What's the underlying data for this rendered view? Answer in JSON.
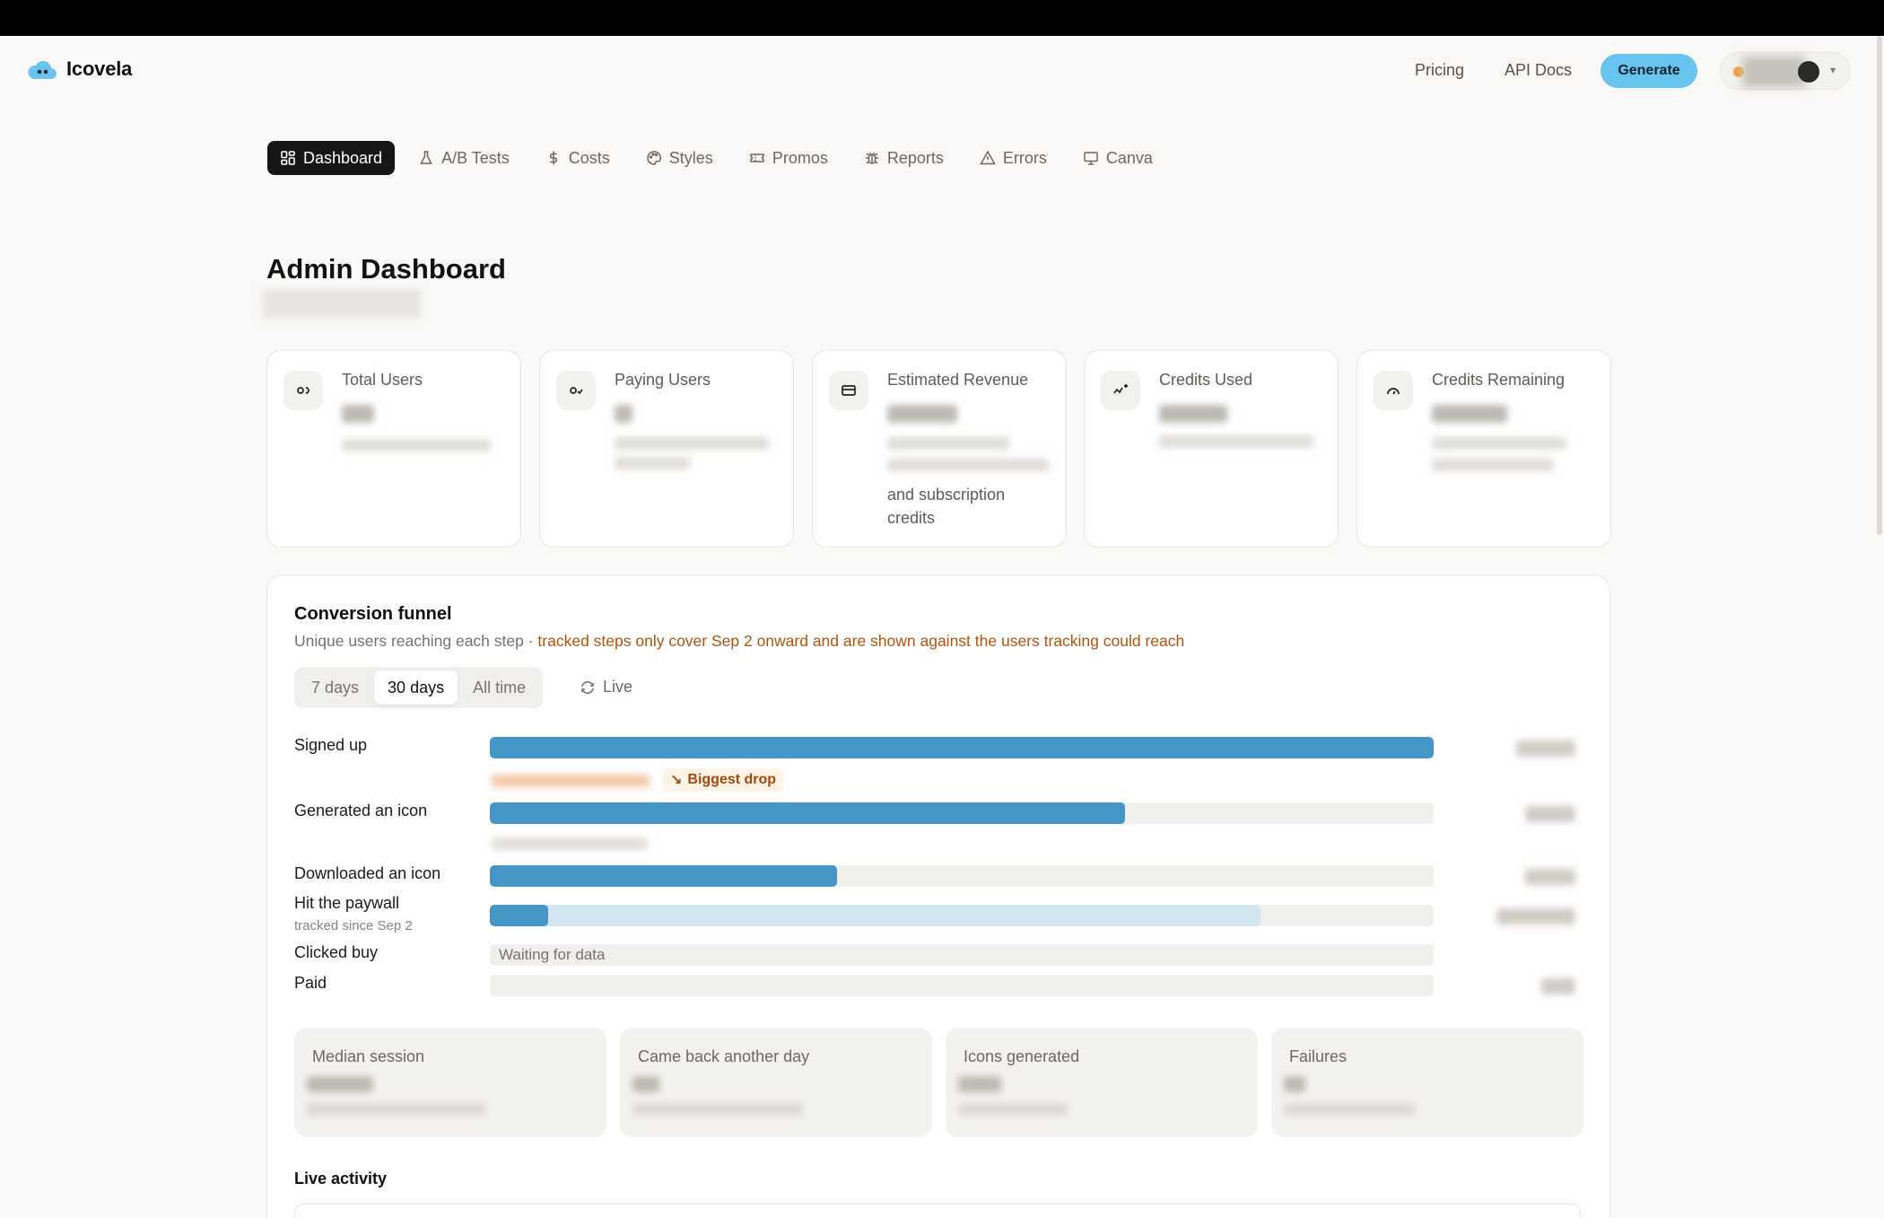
{
  "app": {
    "name": "Icovela"
  },
  "header": {
    "nav": [
      {
        "label": "Pricing"
      },
      {
        "label": "API Docs"
      }
    ],
    "generate_label": "Generate"
  },
  "tabs": [
    {
      "label": "Dashboard",
      "icon": "dashboard-icon",
      "active": true
    },
    {
      "label": "A/B Tests",
      "icon": "flask-icon"
    },
    {
      "label": "Costs",
      "icon": "dollar-icon"
    },
    {
      "label": "Styles",
      "icon": "palette-icon"
    },
    {
      "label": "Promos",
      "icon": "ticket-icon"
    },
    {
      "label": "Reports",
      "icon": "bug-icon"
    },
    {
      "label": "Errors",
      "icon": "warning-icon"
    },
    {
      "label": "Canva",
      "icon": "monitor-icon"
    }
  ],
  "page": {
    "title": "Admin Dashboard"
  },
  "stats": [
    {
      "label": "Total Users",
      "icon": "users-icon"
    },
    {
      "label": "Paying Users",
      "icon": "user-check-icon"
    },
    {
      "label": "Estimated Revenue",
      "icon": "card-icon",
      "note": "and subscription credits"
    },
    {
      "label": "Credits Used",
      "icon": "activity-icon"
    },
    {
      "label": "Credits Remaining",
      "icon": "gauge-icon"
    }
  ],
  "funnel": {
    "title": "Conversion funnel",
    "description": "Unique users reaching each step",
    "warning": " · tracked steps only cover Sep 2 onward and are shown against the users tracking could reach",
    "ranges": [
      {
        "label": "7 days"
      },
      {
        "label": "30 days",
        "active": true
      },
      {
        "label": "All time"
      }
    ],
    "live_label": "Live",
    "biggest_drop_label": "Biggest drop",
    "steps": [
      {
        "label": "Signed up",
        "fill": 1.0
      },
      {
        "label": "Generated an icon",
        "fill": 0.673
      },
      {
        "label": "Downloaded an icon",
        "fill": 0.368
      },
      {
        "label": "Hit the paywall",
        "sub": "tracked since Sep 2",
        "fill": 0.062,
        "tracked_reach": 0.817
      },
      {
        "label": "Clicked buy",
        "empty_text": "Waiting for data"
      },
      {
        "label": "Paid"
      }
    ],
    "accent_color": "#4496c6"
  },
  "metrics": [
    {
      "label": "Median session"
    },
    {
      "label": "Came back another day"
    },
    {
      "label": "Icons generated"
    },
    {
      "label": "Failures"
    }
  ],
  "live_activity": {
    "title": "Live activity"
  }
}
